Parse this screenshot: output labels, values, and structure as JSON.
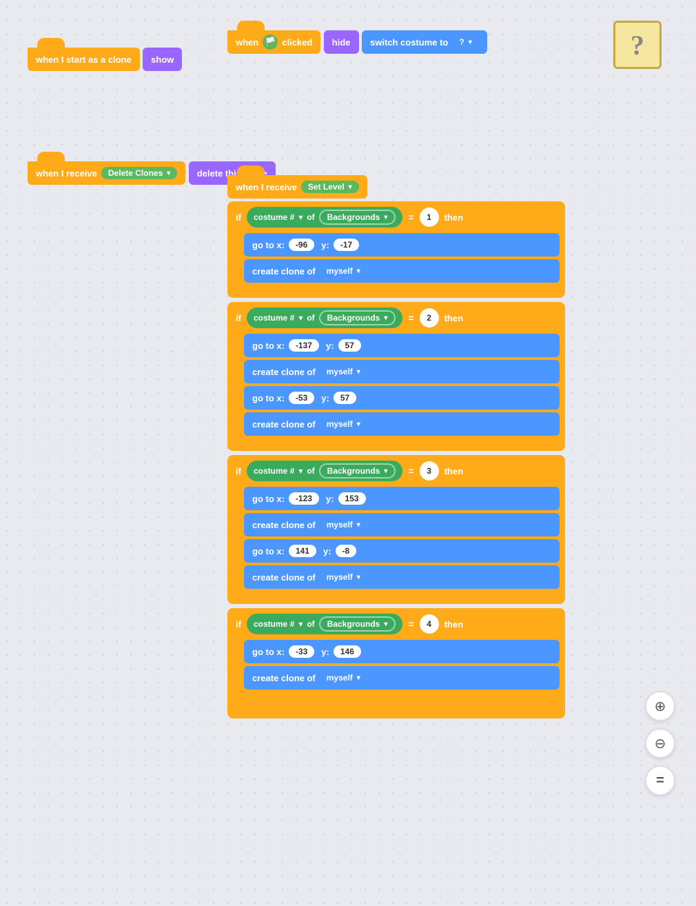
{
  "blocks": {
    "hat1": {
      "label": "when I start as a clone"
    },
    "show": {
      "label": "show"
    },
    "hat2": {
      "label": "when I receive"
    },
    "receive_label": "Delete Clones",
    "delete_clone": {
      "label": "delete this clone"
    },
    "hat3": {
      "label": "when"
    },
    "clicked": {
      "label": "clicked"
    },
    "hide": {
      "label": "hide"
    },
    "switch_costume": {
      "label": "switch costume to"
    },
    "costume_val": "?",
    "hat4": {
      "label": "when I receive"
    },
    "set_level": "Set Level",
    "if_label": "if",
    "costume_hash": "costume #",
    "of_label": "of",
    "backgrounds": "Backgrounds",
    "eq_label": "=",
    "then_label": "then",
    "go_to": "go to x:",
    "y_label": "y:",
    "create_clone": "create clone of",
    "myself": "myself",
    "blocks_if1": {
      "num": "1",
      "x": "-96",
      "y": "-17"
    },
    "blocks_if2": {
      "num": "2",
      "x1": "-137",
      "y1": "57",
      "x2": "-53",
      "y2": "57"
    },
    "blocks_if3": {
      "num": "3",
      "x1": "-123",
      "y1": "153",
      "x2": "141",
      "y2": "-8"
    },
    "blocks_if4": {
      "num": "4",
      "x": "-33",
      "y": "146"
    }
  },
  "zoom": {
    "in": "+",
    "out": "−",
    "fit": "="
  }
}
